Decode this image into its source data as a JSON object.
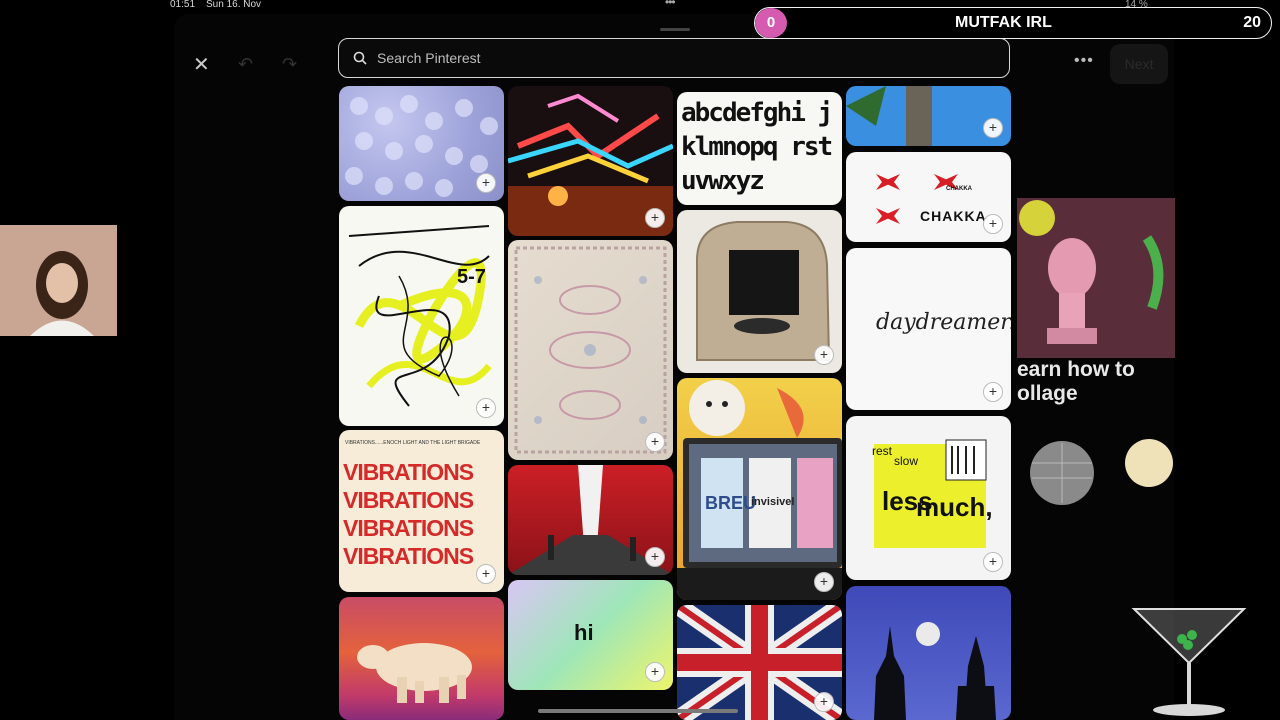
{
  "status_bar": {
    "time": "01:51",
    "date": "Sun 16. Nov",
    "battery": "14 %"
  },
  "app": {
    "next_label": "Next",
    "search": {
      "placeholder": "Search Pinterest"
    }
  },
  "pins": [
    {
      "id": "pin-blue-dots",
      "alt": ""
    },
    {
      "id": "pin-neon-lights",
      "alt": ""
    },
    {
      "id": "pin-alphabet",
      "text": "abcdefghi jklmnopq rstuvwxyz"
    },
    {
      "id": "pin-tree",
      "alt": ""
    },
    {
      "id": "pin-chakka",
      "text": "CHAKKA",
      "small_text": "CHAKKA"
    },
    {
      "id": "pin-scribble-poster",
      "text": "5-7"
    },
    {
      "id": "pin-rug",
      "alt": ""
    },
    {
      "id": "pin-stone-sculpture",
      "alt": ""
    },
    {
      "id": "pin-daydreamer",
      "text": "daydreamer."
    },
    {
      "id": "pin-vibrations",
      "text": "VIBRATIONS",
      "header": "VIBRATIONS......ENOCH LIGHT AND THE LIGHT BRIGADE"
    },
    {
      "id": "pin-red-tunnel",
      "alt": ""
    },
    {
      "id": "pin-laptop-design",
      "text_a": "BREU",
      "text_b": "invisivel"
    },
    {
      "id": "pin-less-much",
      "text_a": "less",
      "text_b": "much,",
      "text_c": "rest",
      "text_d": "slow"
    },
    {
      "id": "pin-polar-bear",
      "alt": ""
    },
    {
      "id": "pin-gradient-hi",
      "text": "hi"
    },
    {
      "id": "pin-union-jack",
      "alt": ""
    },
    {
      "id": "pin-skyline-moon",
      "alt": ""
    }
  ],
  "side_card": {
    "title": "earn how to ollage"
  },
  "overlay": {
    "count": "0",
    "name": "MUTFAK IRL",
    "goal": "20"
  },
  "colors": {
    "overlay_badge": "#d55bb1",
    "background": "#000000"
  }
}
